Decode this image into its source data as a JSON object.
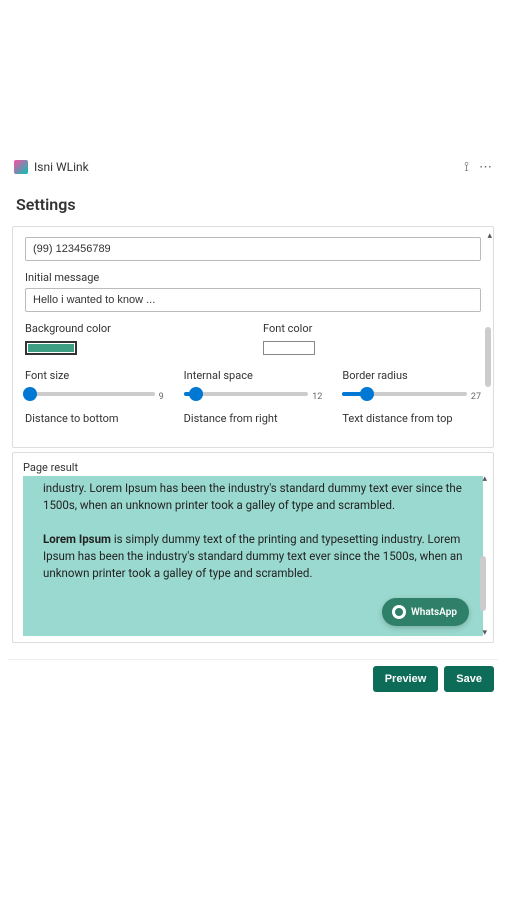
{
  "app": {
    "title": "Isni WLink"
  },
  "page": {
    "heading": "Settings"
  },
  "form": {
    "phone": {
      "value": "(99) 123456789"
    },
    "initialMessage": {
      "label": "Initial message",
      "value": "Hello i wanted to know ..."
    },
    "backgroundColor": {
      "label": "Background color",
      "hex": "#3e9e84"
    },
    "fontColor": {
      "label": "Font color",
      "hex": "#ffffff"
    },
    "fontSize": {
      "label": "Font size",
      "value": "9",
      "pct": 4
    },
    "internalSpace": {
      "label": "Internal space",
      "value": "12",
      "pct": 10
    },
    "borderRadius": {
      "label": "Border radius",
      "value": "27",
      "pct": 20
    },
    "distanceBottom": {
      "label": "Distance to bottom"
    },
    "distanceRight": {
      "label": "Distance from right"
    },
    "textDistanceTop": {
      "label": "Text distance from top"
    }
  },
  "result": {
    "sectionLabel": "Page result",
    "para1": "industry. Lorem Ipsum has been the industry's standard dummy text ever since the 1500s, when an unknown printer took a galley of type and scrambled.",
    "para2_lead": "Lorem Ipsum",
    "para2_rest": " is simply dummy text of the printing and typesetting industry. Lorem Ipsum has been the industry's standard dummy text ever since the 1500s, when an unknown printer took a galley of type and scrambled.",
    "badge": "WhatsApp"
  },
  "footer": {
    "preview": "Preview",
    "save": "Save"
  }
}
